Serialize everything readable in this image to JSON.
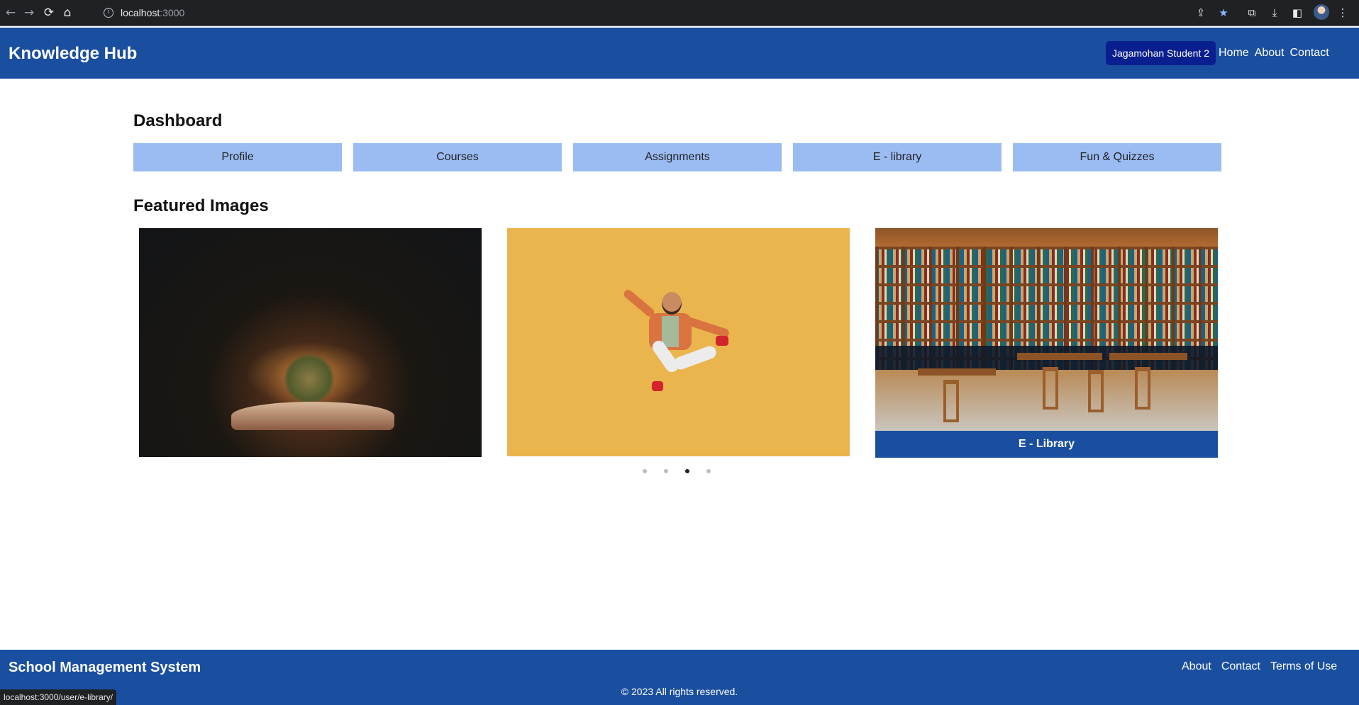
{
  "browser": {
    "url_host": "localhost",
    "url_port": ":3000",
    "status_url": "localhost:3000/user/e-library/"
  },
  "header": {
    "brand": "Knowledge Hub",
    "user_badge": "Jagamohan Student 2",
    "nav": [
      "Home",
      "About",
      "Contact"
    ]
  },
  "main": {
    "dashboard_title": "Dashboard",
    "dashboard_buttons": [
      "Profile",
      "Courses",
      "Assignments",
      "E - library",
      "Fun & Quizzes"
    ],
    "featured_title": "Featured Images",
    "featured_caption": "E - Library",
    "carousel": {
      "total": 4,
      "active_index": 2
    }
  },
  "footer": {
    "title": "School Management System",
    "links": [
      "About",
      "Contact",
      "Terms of Use"
    ],
    "copyright": "© 2023 All rights reserved."
  },
  "colors": {
    "primary_blue": "#1a4fa0",
    "badge_navy": "#0a1f8f",
    "dashboard_button": "#9bbcf3"
  }
}
